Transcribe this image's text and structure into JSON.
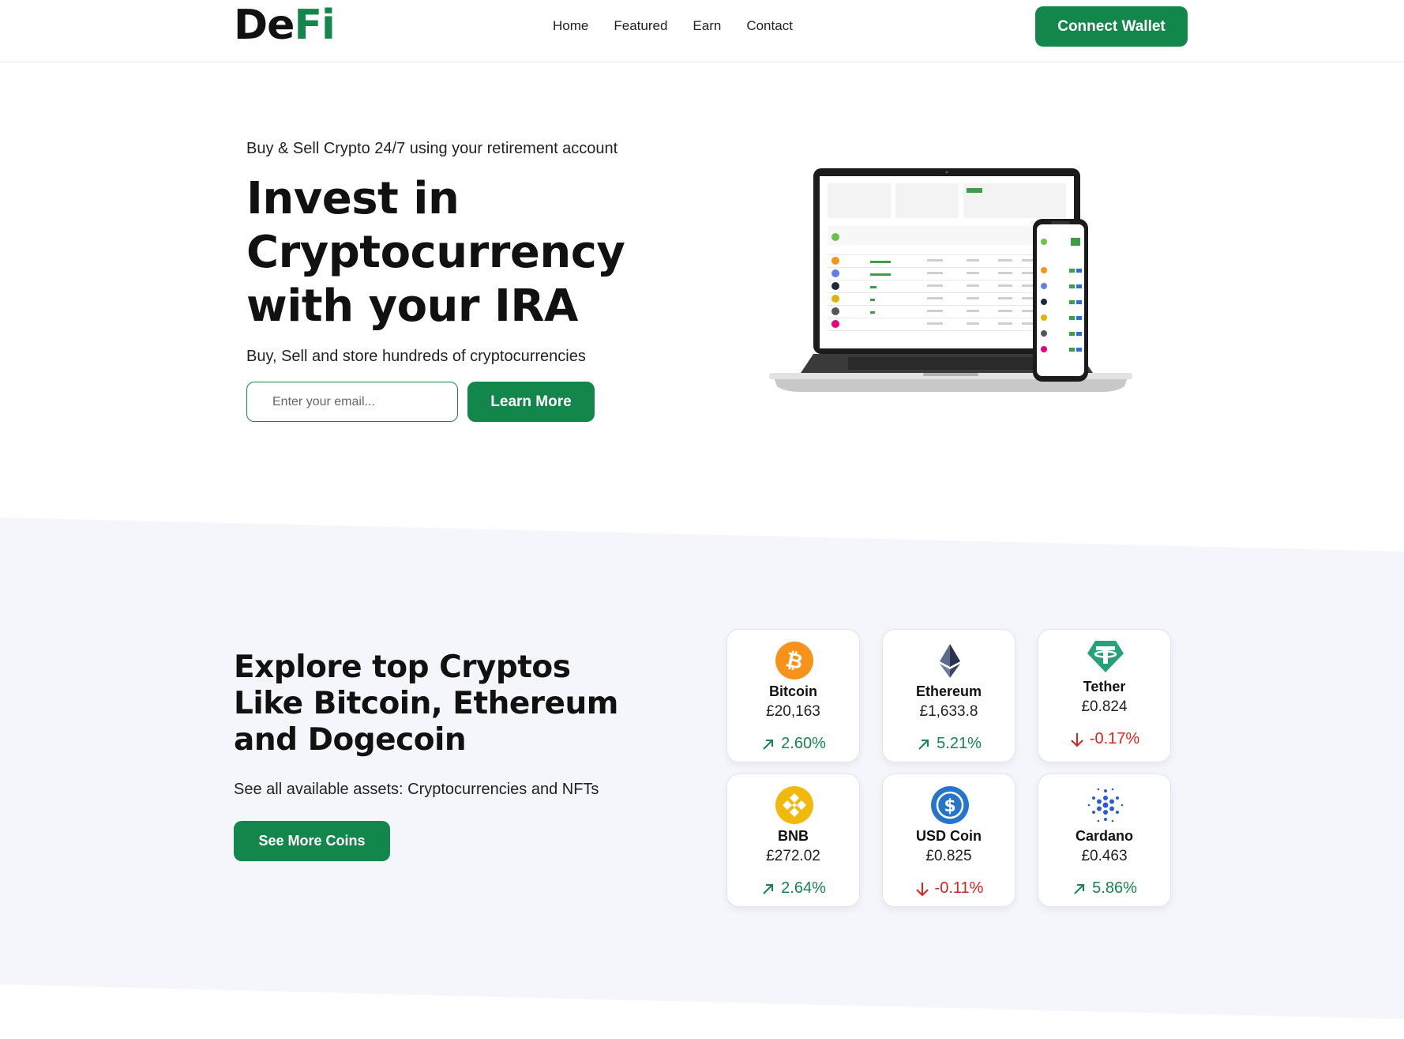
{
  "brand": {
    "part1": "De",
    "part2": "Fi"
  },
  "nav": {
    "items": [
      "Home",
      "Featured",
      "Earn",
      "Contact"
    ]
  },
  "header": {
    "connect_label": "Connect Wallet"
  },
  "hero": {
    "subtitle": "Buy & Sell Crypto 24/7 using your retirement account",
    "title": "Invest in Cryptocurrency with your IRA",
    "description": "Buy, Sell and store hundreds of cryptocurrencies",
    "email_placeholder": "Enter your email...",
    "cta_label": "Learn More"
  },
  "explore": {
    "title": "Explore top Cryptos Like Bitcoin, Ethereum and Dogecoin",
    "description": "See all available assets: Cryptocurrencies and NFTs",
    "cta_label": "See More Coins"
  },
  "coins": [
    {
      "name": "Bitcoin",
      "price": "£20,163",
      "change": "2.60%",
      "direction": "up",
      "icon": "bitcoin-icon"
    },
    {
      "name": "Ethereum",
      "price": "£1,633.8",
      "change": "5.21%",
      "direction": "up",
      "icon": "ethereum-icon"
    },
    {
      "name": "Tether",
      "price": "£0.824",
      "change": "-0.17%",
      "direction": "down",
      "icon": "tether-icon"
    },
    {
      "name": "BNB",
      "price": "£272.02",
      "change": "2.64%",
      "direction": "up",
      "icon": "bnb-icon"
    },
    {
      "name": "USD Coin",
      "price": "£0.825",
      "change": "-0.11%",
      "direction": "down",
      "icon": "usd-coin-icon"
    },
    {
      "name": "Cardano",
      "price": "£0.463",
      "change": "5.86%",
      "direction": "up",
      "icon": "cardano-icon"
    }
  ],
  "colors": {
    "accent": "#13874b",
    "down": "#e0201c",
    "band": "#f4f6fb"
  }
}
